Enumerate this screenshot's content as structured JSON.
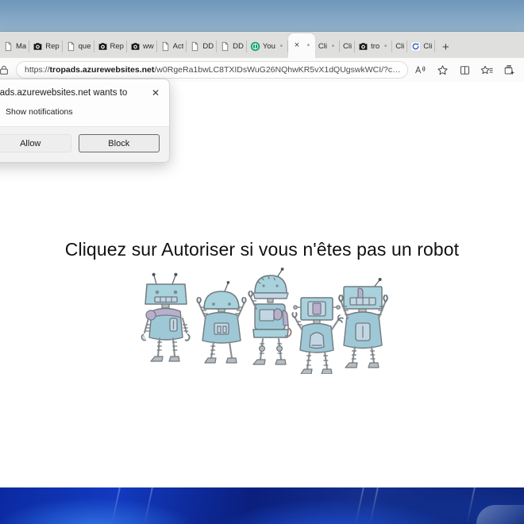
{
  "window": {
    "browser": "Microsoft Edge"
  },
  "tabs": {
    "items": [
      {
        "title": "Ma",
        "favicon": "generic-page-icon",
        "has_dot": false
      },
      {
        "title": "Rep",
        "favicon": "black-camera-icon",
        "has_dot": false
      },
      {
        "title": "que",
        "favicon": "generic-page-icon",
        "has_dot": false
      },
      {
        "title": "Rep",
        "favicon": "black-camera-icon",
        "has_dot": false
      },
      {
        "title": "ww",
        "favicon": "black-camera-icon",
        "has_dot": false
      },
      {
        "title": "Act",
        "favicon": "generic-page-icon",
        "has_dot": false
      },
      {
        "title": "DD",
        "favicon": "generic-page-icon",
        "has_dot": false
      },
      {
        "title": "DD",
        "favicon": "generic-page-icon",
        "has_dot": false
      },
      {
        "title": "You",
        "favicon": "green-circle-icon",
        "has_dot": true
      },
      {
        "title": "",
        "favicon": "none",
        "has_dot": true,
        "active": true,
        "close_glyph": "×"
      },
      {
        "title": "Cli",
        "favicon": "none",
        "has_dot": true
      },
      {
        "title": "Cli",
        "favicon": "none",
        "has_dot": false
      },
      {
        "title": "tro",
        "favicon": "black-camera-icon",
        "has_dot": true
      },
      {
        "title": "Cli",
        "favicon": "none",
        "has_dot": false
      },
      {
        "title": "Cli",
        "favicon": "blue-refresh-icon",
        "has_dot": false
      }
    ],
    "new_tab_glyph": "+"
  },
  "toolbar": {
    "url_scheme": "https://",
    "url_domain": "tropads.azurewebsites.net",
    "url_path": "/w0RgeRa1bwLC8TXIDsWuG26NQhwKR5vX1dQUgswkWCI/?cid=...",
    "icons": {
      "site_info": "site-info-icon",
      "read_aloud": "read-aloud-icon",
      "favorite": "favorite-star-icon",
      "split_screen": "split-screen-icon",
      "favorites": "favorites-icon",
      "collections": "collections-icon"
    }
  },
  "permission_dialog": {
    "title": "opads.azurewebsites.net wants to",
    "option_label": "Show notifications",
    "option_icon": "bell-icon",
    "close_glyph": "✕",
    "allow_label": "Allow",
    "block_label": "Block"
  },
  "page": {
    "heading": "Cliquez sur Autoriser si vous n'êtes pas un robot",
    "illustration": "five-cartoon-robots",
    "background_color": "#ffffff",
    "heading_color": "#111111"
  },
  "colors": {
    "tab_strip": "#dfdfde",
    "toolbar": "#fbfbfb",
    "active_tab": "#fbfbfb",
    "robot_body": "#a8d2dc",
    "robot_outline": "#6f7a82",
    "taskbar_blue": "#0a1f8f",
    "desktop_sky": "#86a9c6"
  }
}
